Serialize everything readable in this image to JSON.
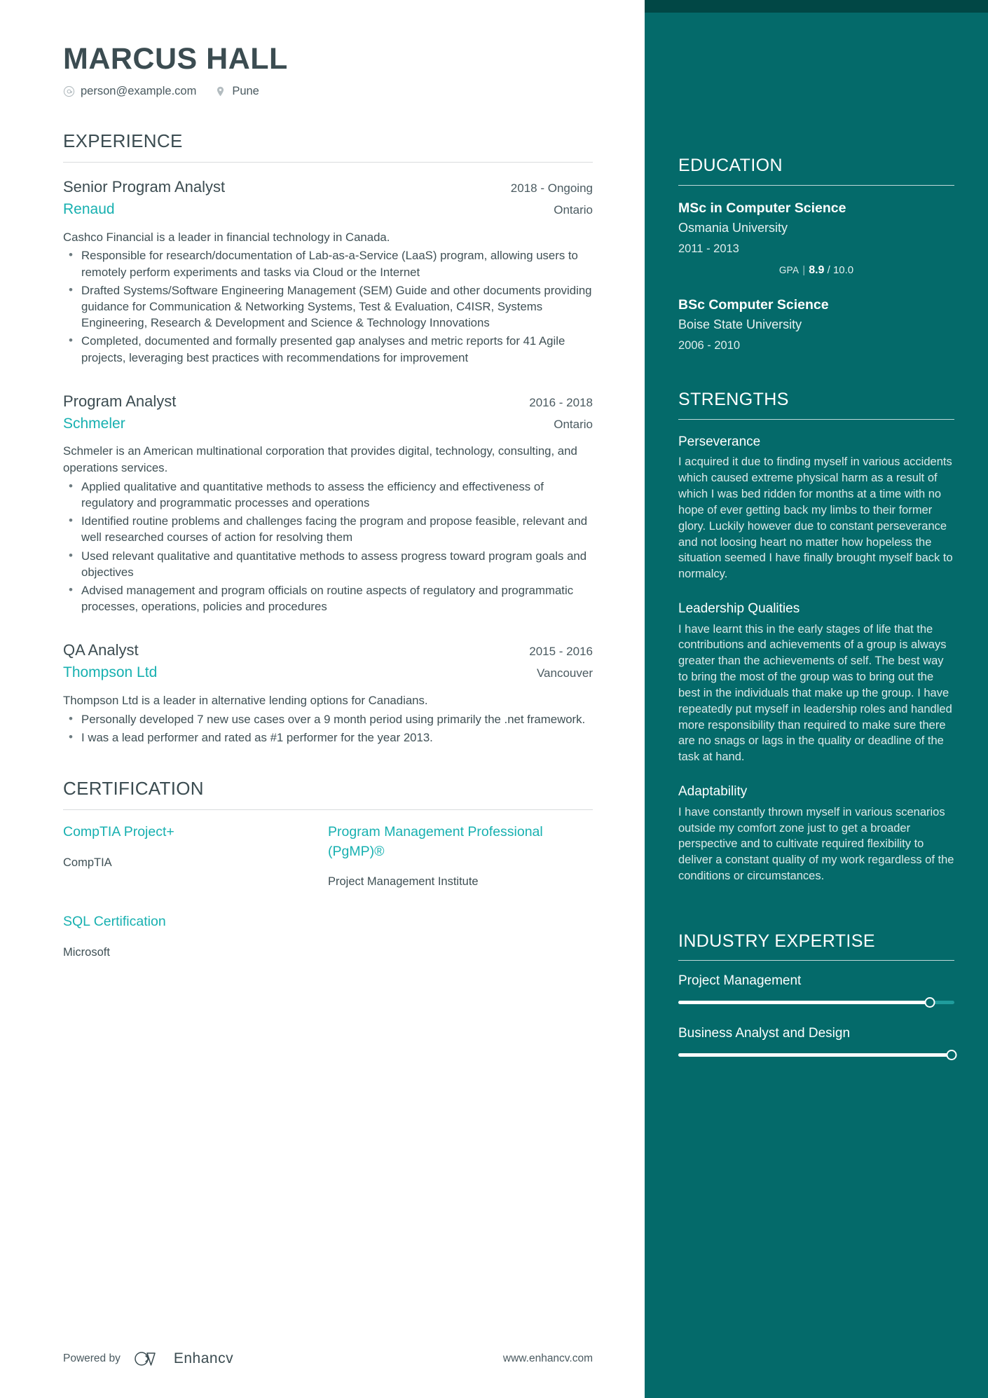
{
  "header": {
    "name": "MARCUS HALL",
    "contacts": [
      {
        "icon": "email-icon",
        "value": "person@example.com"
      },
      {
        "icon": "location-pin-icon",
        "value": "Pune"
      }
    ]
  },
  "main": {
    "experience": {
      "title": "EXPERIENCE",
      "jobs": [
        {
          "title": "Senior Program Analyst",
          "dates": "2018 - Ongoing",
          "company": "Renaud",
          "location": "Ontario",
          "description": "Cashco Financial is a leader in financial technology in Canada.",
          "bullets": [
            "Responsible for research/documentation of Lab-as-a-Service (LaaS) program, allowing users to remotely perform experiments and tasks via Cloud or the Internet",
            "Drafted Systems/Software Engineering Management (SEM) Guide and other documents providing guidance for Communication & Networking Systems, Test & Evaluation, C4ISR, Systems Engineering, Research & Development and Science & Technology Innovations",
            "Completed, documented and formally presented gap analyses and metric reports for 41 Agile projects, leveraging best practices with recommendations for improvement"
          ]
        },
        {
          "title": "Program Analyst",
          "dates": "2016 - 2018",
          "company": "Schmeler",
          "location": "Ontario",
          "description": "Schmeler is an American multinational corporation that provides digital, technology, consulting, and operations services.",
          "bullets": [
            "Applied qualitative and quantitative methods to assess the efficiency and effectiveness of regulatory and programmatic processes and operations",
            "Identified routine problems and challenges facing the program and propose feasible, relevant and well researched courses of action for resolving them",
            "Used relevant qualitative and quantitative methods to assess progress toward program goals and objectives",
            "Advised management and program officials on routine aspects of regulatory and programmatic processes, operations, policies and procedures"
          ]
        },
        {
          "title": "QA Analyst",
          "dates": "2015 - 2016",
          "company": "Thompson Ltd",
          "location": "Vancouver",
          "description": "Thompson Ltd is a leader in alternative lending options for Canadians.",
          "bullets": [
            "Personally developed 7 new use cases over a 9 month period using primarily the .net framework.",
            "I was a lead performer and rated as #1 performer for the year 2013."
          ]
        }
      ]
    },
    "certification": {
      "title": "CERTIFICATION",
      "items": [
        {
          "name": "CompTIA Project+",
          "org": "CompTIA"
        },
        {
          "name": "Program Management Professional (PgMP)®",
          "org": "Project Management Institute"
        },
        {
          "name": "SQL Certification",
          "org": "Microsoft"
        }
      ]
    }
  },
  "sidebar": {
    "education": {
      "title": "EDUCATION",
      "items": [
        {
          "degree": "MSc in Computer Science",
          "school": "Osmania University",
          "dates": "2011 - 2013",
          "gpa_label": "GPA",
          "gpa_value": "8.9",
          "gpa_max": "/ 10.0"
        },
        {
          "degree": "BSc Computer Science",
          "school": "Boise State University",
          "dates": "2006 - 2010",
          "gpa_label": "",
          "gpa_value": "",
          "gpa_max": ""
        }
      ]
    },
    "strengths": {
      "title": "STRENGTHS",
      "items": [
        {
          "name": "Perseverance",
          "text": "I acquired it due to finding myself in various accidents which caused extreme physical harm as a result of which I was bed ridden for months at a time with no hope of ever getting back my limbs to their former glory. Luckily however due to constant perseverance and not loosing heart no matter how hopeless the situation seemed I have finally brought myself back to normalcy."
        },
        {
          "name": "Leadership Qualities",
          "text": "I have learnt this in the early stages of life that the contributions and achievements of a group is always greater than the achievements of self. The best way to bring the most of the group was to bring out the best in the individuals that make up the group. I have repeatedly put myself in leadership roles and handled more responsibility than required to make sure there are no snags or lags in the quality or deadline of the task at hand."
        },
        {
          "name": "Adaptability",
          "text": "I have constantly thrown myself in various scenarios outside my comfort zone just to get a broader perspective and to cultivate required flexibility to deliver a constant quality of my work regardless of the conditions or circumstances."
        }
      ]
    },
    "industry_expertise": {
      "title": "INDUSTRY EXPERTISE",
      "items": [
        {
          "name": "Project Management",
          "level": 91
        },
        {
          "name": "Business Analyst and Design",
          "level": 99
        }
      ]
    }
  },
  "footer": {
    "powered_by": "Powered by",
    "brand": "Enhancv",
    "url": "www.enhancv.com"
  },
  "colors": {
    "sidebar_bg": "#046A6A",
    "sidebar_top": "#014745",
    "accent_teal": "#17b0b0",
    "text_dark": "#3b4c51"
  }
}
